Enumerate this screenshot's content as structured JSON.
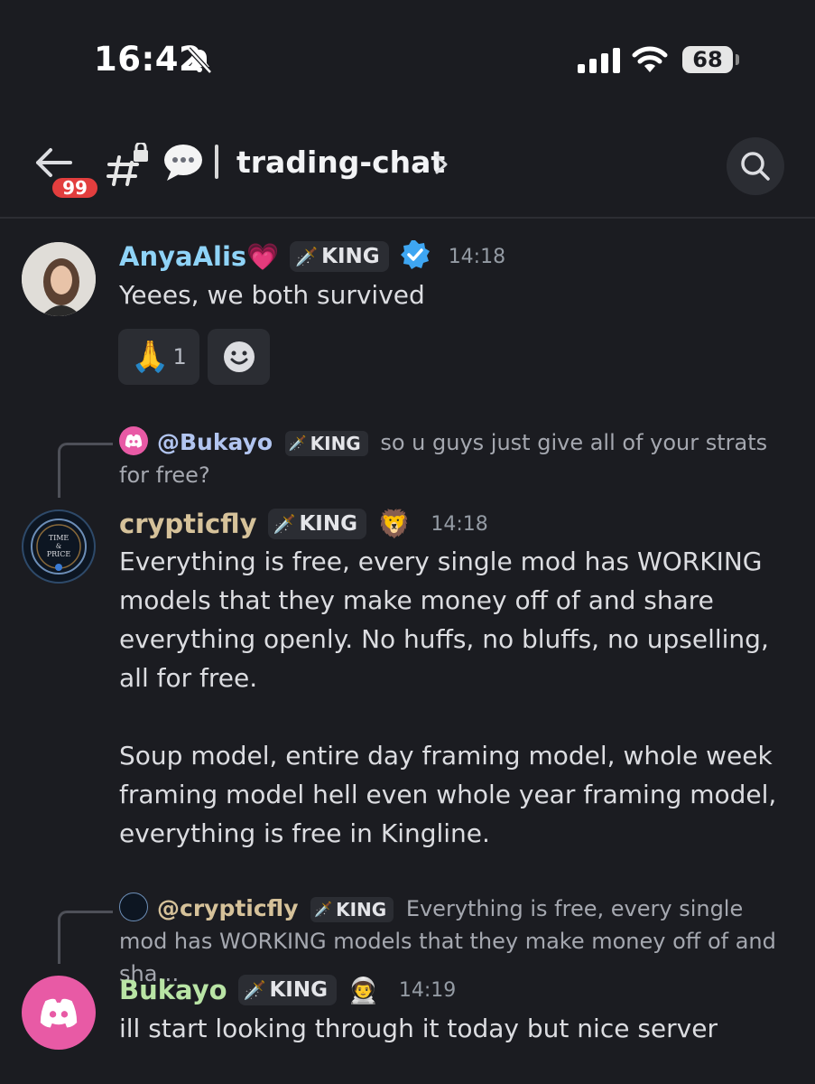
{
  "status_bar": {
    "time": "16:42",
    "battery": "68",
    "icons": [
      "bell-slash-icon",
      "cellular-signal-icon",
      "wifi-icon",
      "battery-icon"
    ]
  },
  "header": {
    "unread_count": "99",
    "channel_name": "trading-chat",
    "channel_icons": [
      "hash-lock-icon",
      "speech-bubble-icon"
    ],
    "colors": {
      "badge": "#e23e3e",
      "background": "#1b1c21"
    }
  },
  "messages": [
    {
      "author": "AnyaAlis💗",
      "author_color": "#8fd3f7",
      "role_tag": "KING",
      "verified": true,
      "timestamp": "14:18",
      "text": "Yeees, we both survived",
      "reactions": [
        {
          "emoji": "🙏",
          "count": "1"
        }
      ]
    },
    {
      "reply": {
        "author": "@Bukayo",
        "role_tag": "KING",
        "text": "so u guys just give all of your strats for free?"
      },
      "author": "crypticfly",
      "author_color": "#d6c29a",
      "role_tag": "KING",
      "badge_emoji": "🦁",
      "timestamp": "14:18",
      "avatar_text": [
        "TIME",
        "&",
        "PRICE"
      ],
      "paragraphs": [
        "Everything is free, every single mod has WORKING models that they make money off of and share everything openly. No huffs, no bluffs, no upselling, all for free.",
        "Soup model, entire day framing model, whole week framing model hell even whole year framing model, everything is free in Kingline."
      ]
    },
    {
      "reply": {
        "author": "@crypticfly",
        "role_tag": "KING",
        "text": "Everything is free, every single mod has WORKING models that they make money off of and sha…"
      },
      "author": "Bukayo",
      "author_color": "#b9e4a5",
      "role_tag": "KING",
      "badge_emoji": "👨‍🚀",
      "timestamp": "14:19",
      "text": "ill start looking through it today but nice server"
    }
  ]
}
